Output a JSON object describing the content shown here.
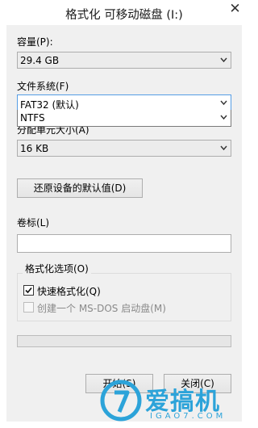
{
  "window": {
    "title": "格式化 可移动磁盘 (I:)",
    "close_glyph": "✕"
  },
  "capacity": {
    "label": "容量(P):",
    "value": "29.4 GB"
  },
  "filesystem": {
    "label": "文件系统(F)",
    "value": "FAT32 (默认)",
    "dropdown_option": "NTFS"
  },
  "allocation": {
    "label": "分配单元大小(A)",
    "value": "16 KB"
  },
  "restore_defaults": {
    "label": "还原设备的默认值(D)"
  },
  "volume_label": {
    "label": "卷标(L)",
    "value": ""
  },
  "format_options": {
    "title": "格式化选项(O)",
    "quick_format": {
      "label": "快速格式化(Q)",
      "checked": true
    },
    "msdos_disk": {
      "label": "创建一个 MS-DOS 启动盘(M)",
      "checked": false,
      "disabled": true
    }
  },
  "progress": {
    "fraction": 0
  },
  "buttons": {
    "start": "开始(S)",
    "close": "关闭(C)"
  },
  "watermark": {
    "chinese": "爱搞机",
    "url": "IGAO7.COM",
    "color": "#2ca3d9"
  }
}
